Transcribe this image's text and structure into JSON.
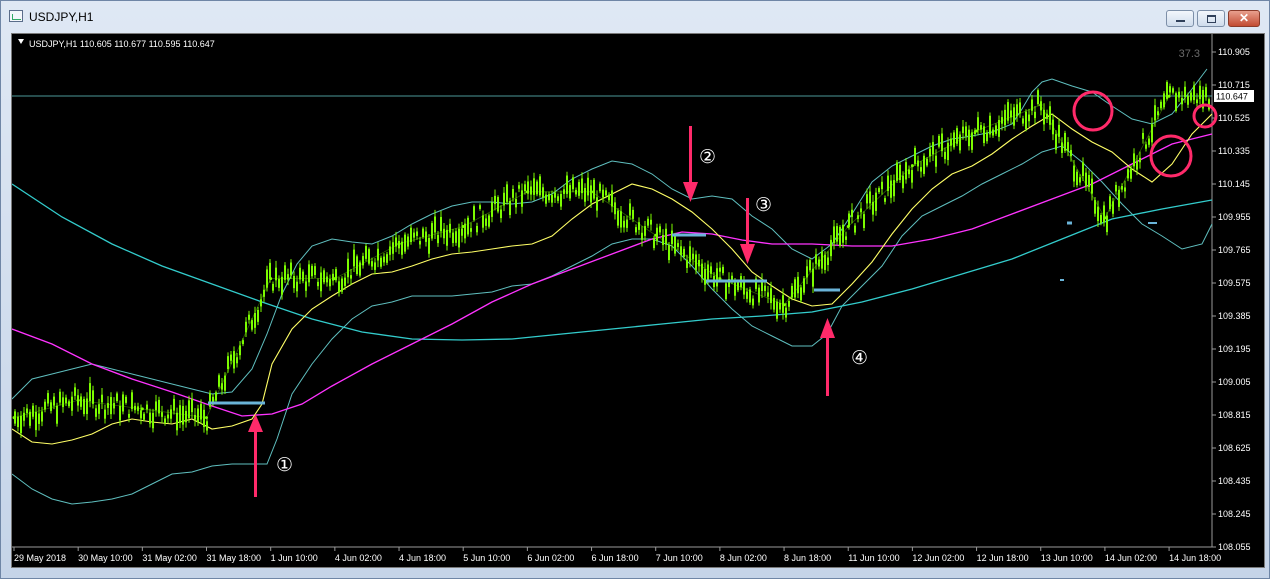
{
  "window": {
    "title": "USDJPY,H1",
    "close_glyph": "✕"
  },
  "chart": {
    "header": "USDJPY,H1  110.605 110.677 110.595 110.647",
    "corner_value": "37.3",
    "current_price": "110.647",
    "price_ticks": [
      "110.905",
      "110.715",
      "110.525",
      "110.335",
      "110.145",
      "109.955",
      "109.765",
      "109.575",
      "109.385",
      "109.195",
      "109.005",
      "108.815",
      "108.625",
      "108.435",
      "108.245",
      "108.055"
    ],
    "time_ticks": [
      "29 May 2018",
      "30 May 10:00",
      "31 May 02:00",
      "31 May 18:00",
      "1 Jun 10:00",
      "4 Jun 02:00",
      "4 Jun 18:00",
      "5 Jun 10:00",
      "6 Jun 02:00",
      "6 Jun 18:00",
      "7 Jun 10:00",
      "8 Jun 02:00",
      "8 Jun 18:00",
      "11 Jun 10:00",
      "12 Jun 02:00",
      "12 Jun 18:00",
      "13 Jun 10:00",
      "14 Jun 02:00",
      "14 Jun 18:00"
    ],
    "annotations": {
      "label_1": "①",
      "label_2": "②",
      "label_3": "③",
      "label_4": "④"
    },
    "colors": {
      "background": "#000000",
      "candles": "#7CFC00",
      "bollinger": "#5fbfbf",
      "ma_fast": "#ffff66",
      "ma_mid": "#ff33ff",
      "ma_slow": "#33cccc",
      "arrows": "#ff2a6a",
      "level_lines": "#6ab4d8"
    },
    "icons": [
      "dropdown-triangle-icon",
      "chart-window-icon",
      "minimize-icon",
      "maximize-icon",
      "close-icon"
    ]
  },
  "chart_data": {
    "type": "line",
    "title": "USDJPY,H1",
    "ylim": [
      108.055,
      110.905
    ],
    "x": [
      "29 May 2018",
      "30 May 10:00",
      "31 May 02:00",
      "31 May 18:00",
      "1 Jun 10:00",
      "4 Jun 02:00",
      "4 Jun 18:00",
      "5 Jun 10:00",
      "6 Jun 02:00",
      "6 Jun 18:00",
      "7 Jun 10:00",
      "8 Jun 02:00",
      "8 Jun 18:00",
      "11 Jun 10:00",
      "12 Jun 02:00",
      "12 Jun 18:00",
      "13 Jun 10:00",
      "14 Jun 02:00",
      "14 Jun 18:00"
    ],
    "series": [
      {
        "values": [
          108.8,
          108.9,
          108.85,
          108.8,
          109.6,
          109.6,
          109.8,
          109.9,
          110.1,
          110.1,
          109.85,
          109.6,
          109.45,
          109.9,
          110.25,
          110.45,
          110.6,
          109.95,
          110.65
        ]
      }
    ]
  }
}
